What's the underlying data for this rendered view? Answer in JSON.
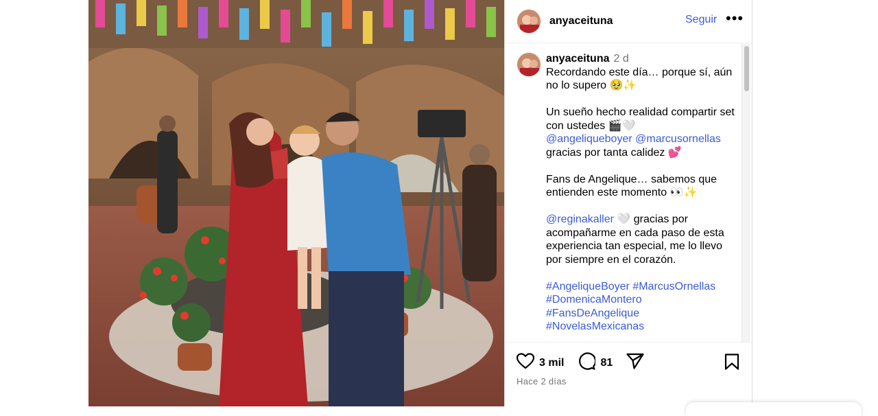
{
  "post": {
    "username": "anyaceituna",
    "follow_label": "Seguir",
    "more_label": "•••",
    "caption": {
      "username": "anyaceituna",
      "time": "2 d",
      "line1": "Recordando este día… porque sí, aún no lo supero 🥹✨",
      "line2_a": "Un sueño hecho realidad compartir set con ustedes 🎬🤍",
      "mention1": "@angeliqueboyer",
      "mention2": "@marcusornellas",
      "line2_b": "gracias por tanta calidez 💕",
      "line3": "Fans de Angelique… sabemos que entienden este momento 👀✨",
      "mention3": "@reginakaller",
      "line4": "🤍 gracias por acompañarme en cada paso de esta experiencia tan especial, me lo llevo por siempre en el corazón.",
      "hashtags": [
        "#AngeliqueBoyer",
        "#MarcusOrnellas",
        "#DomenicaMontero",
        "#FansDeAngelique",
        "#NovelasMexicanas"
      ]
    },
    "likes": "3 mil",
    "comments_count": "81",
    "posted": "Hace 2 días"
  },
  "icons": {
    "like": "heart-icon",
    "comment": "comment-bubble-icon",
    "share": "paper-plane-icon",
    "save": "bookmark-icon",
    "more": "more-options-icon"
  },
  "colors": {
    "link": "#3b5bd6",
    "muted": "#737373",
    "border": "#dbdbdb"
  }
}
